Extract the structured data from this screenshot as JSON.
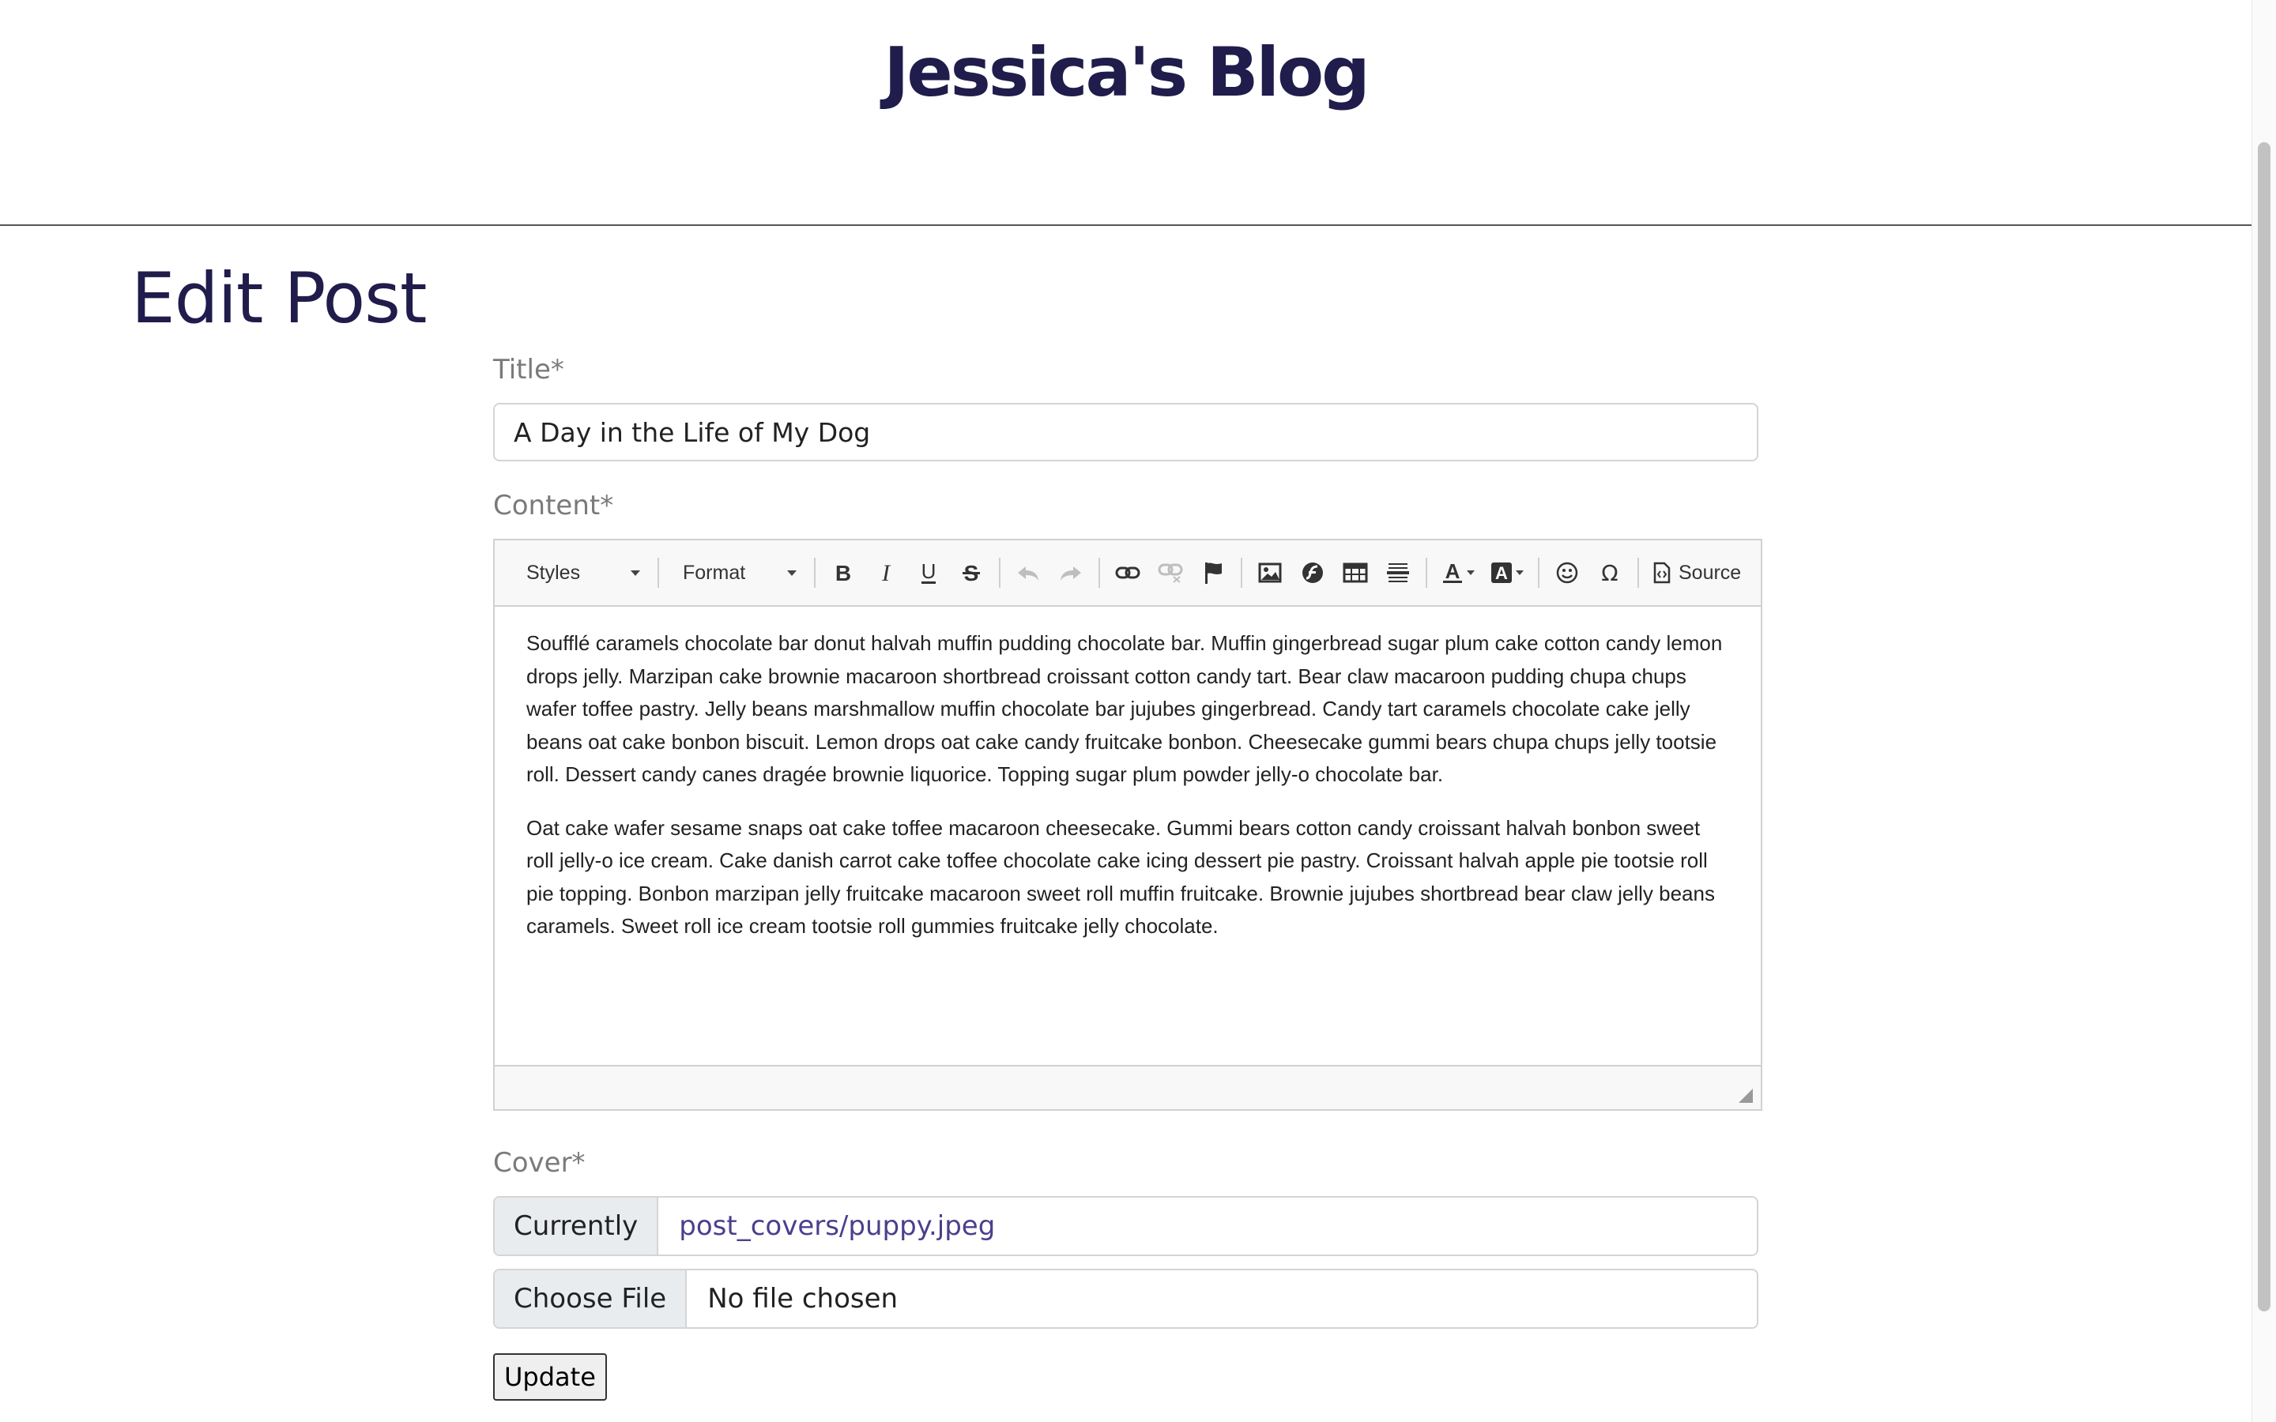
{
  "site": {
    "title": "Jessica's Blog"
  },
  "page": {
    "heading": "Edit Post"
  },
  "form": {
    "title_label": "Title*",
    "title_value": "A Day in the Life of My Dog",
    "content_label": "Content*",
    "cover_label": "Cover*",
    "currently_label": "Currently",
    "current_file": "post_covers/puppy.jpeg",
    "choose_file_label": "Choose File",
    "no_file_text": "No file chosen",
    "submit_label": "Update"
  },
  "editor": {
    "toolbar": {
      "styles_label": "Styles",
      "format_label": "Format",
      "source_label": "Source",
      "buttons": [
        "bold-icon",
        "italic-icon",
        "underline-icon",
        "strikethrough-icon",
        "undo-icon",
        "redo-icon",
        "link-icon",
        "unlink-icon",
        "anchor-flag-icon",
        "image-icon",
        "flash-icon",
        "table-icon",
        "horizontal-line-icon",
        "text-color-icon",
        "background-color-icon",
        "smiley-icon",
        "special-char-omega-icon",
        "source-icon"
      ]
    },
    "paragraphs": [
      "Soufflé caramels chocolate bar donut halvah muffin pudding chocolate bar. Muffin gingerbread sugar plum cake cotton candy lemon drops jelly. Marzipan cake brownie macaroon shortbread croissant cotton candy tart. Bear claw macaroon pudding chupa chups wafer toffee pastry. Jelly beans marshmallow muffin chocolate bar jujubes gingerbread. Candy tart caramels chocolate cake jelly beans oat cake bonbon biscuit. Lemon drops oat cake candy fruitcake bonbon. Cheesecake gummi bears chupa chups jelly tootsie roll. Dessert candy canes dragée brownie liquorice. Topping sugar plum powder jelly-o chocolate bar.",
      "Oat cake wafer sesame snaps oat cake toffee macaroon cheesecake. Gummi bears cotton candy croissant halvah bonbon sweet roll jelly-o ice cream. Cake danish carrot cake toffee chocolate cake icing dessert pie pastry. Croissant halvah apple pie tootsie roll pie topping. Bonbon marzipan jelly fruitcake macaroon sweet roll muffin fruitcake. Brownie jujubes shortbread bear claw jelly beans caramels. Sweet roll ice cream tootsie roll gummies fruitcake jelly chocolate."
    ]
  },
  "colors": {
    "brand_navy": "#201c4b",
    "link_purple": "#4b3f8c",
    "label_gray": "#7a7a7a"
  }
}
